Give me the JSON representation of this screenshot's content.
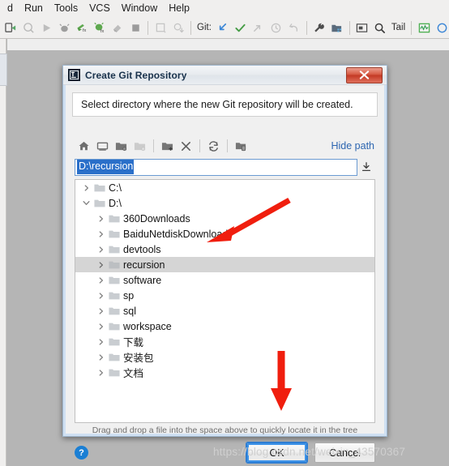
{
  "ide": {
    "menus": [
      {
        "label": "d"
      },
      {
        "label": "Run"
      },
      {
        "label": "Tools"
      },
      {
        "label": "VCS"
      },
      {
        "label": "Window"
      },
      {
        "label": "Help"
      }
    ],
    "toolbar": {
      "git_label": "Git:",
      "tail_label": "Tail"
    }
  },
  "dialog": {
    "title": "Create Git Repository",
    "description": "Select directory where the new Git repository will be created.",
    "close_tooltip": "Close",
    "file_toolbar": {
      "hide_path": "Hide path"
    },
    "path": {
      "value": "D:\\recursion"
    },
    "tree": [
      {
        "label": "C:\\",
        "depth": 0,
        "expanded": false,
        "selected": false
      },
      {
        "label": "D:\\",
        "depth": 0,
        "expanded": true,
        "selected": false
      },
      {
        "label": "360Downloads",
        "depth": 1,
        "expanded": false,
        "selected": false
      },
      {
        "label": "BaiduNetdiskDownload",
        "depth": 1,
        "expanded": false,
        "selected": false
      },
      {
        "label": "devtools",
        "depth": 1,
        "expanded": false,
        "selected": false
      },
      {
        "label": "recursion",
        "depth": 1,
        "expanded": false,
        "selected": true
      },
      {
        "label": "software",
        "depth": 1,
        "expanded": false,
        "selected": false
      },
      {
        "label": "sp",
        "depth": 1,
        "expanded": false,
        "selected": false
      },
      {
        "label": "sql",
        "depth": 1,
        "expanded": false,
        "selected": false
      },
      {
        "label": "workspace",
        "depth": 1,
        "expanded": false,
        "selected": false
      },
      {
        "label": "下载",
        "depth": 1,
        "expanded": false,
        "selected": false
      },
      {
        "label": "安装包",
        "depth": 1,
        "expanded": false,
        "selected": false
      },
      {
        "label": "文档",
        "depth": 1,
        "expanded": false,
        "selected": false
      }
    ],
    "hint": "Drag and drop a file into the space above to quickly locate it in the tree",
    "buttons": {
      "help": "?",
      "ok": "OK",
      "cancel": "Cancel"
    }
  },
  "annotations": {
    "arrow_color": "#f01e0e",
    "arrow_count": 2
  },
  "watermark": "https://blog.csdn.net/weixin_43570367",
  "colors": {
    "selection_blue": "#2a6fc9",
    "link_blue": "#2c65b0",
    "desktop_gray": "#b5b5b5",
    "close_red": "#c43a26"
  }
}
